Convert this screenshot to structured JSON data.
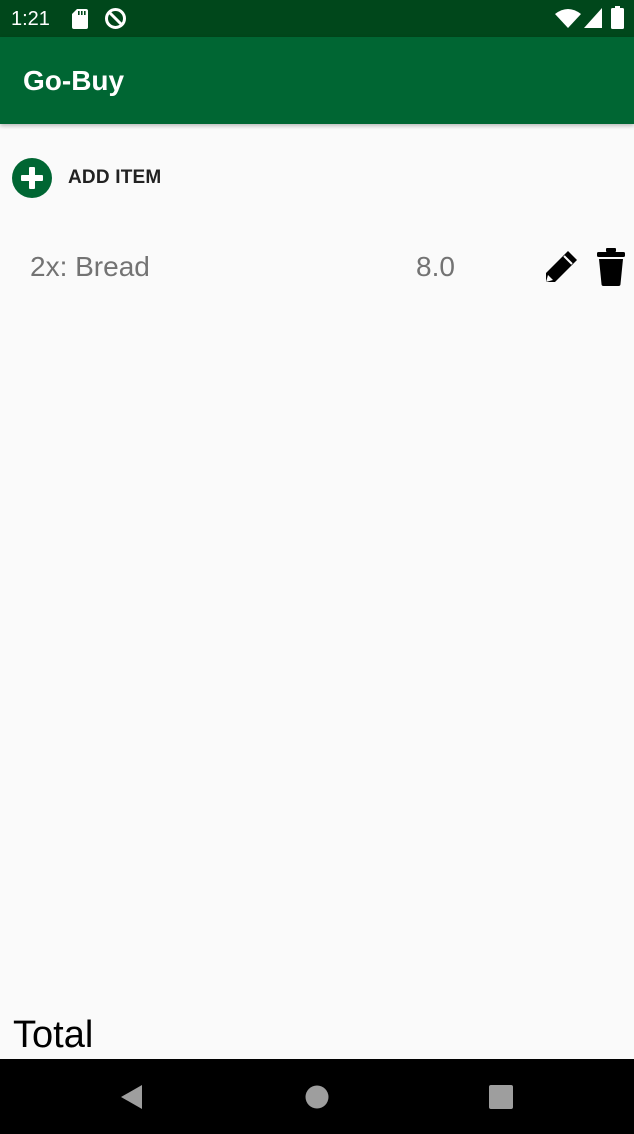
{
  "status_bar": {
    "time": "1:21",
    "icons": [
      "sd-card-icon",
      "data-saver-icon",
      "wifi-icon",
      "signal-icon",
      "battery-icon"
    ]
  },
  "app_bar": {
    "title": "Go-Buy",
    "color": "#006633"
  },
  "add_item": {
    "label": "ADD ITEM",
    "icon": "add-circle-icon",
    "color": "#006633"
  },
  "items": [
    {
      "name": "2x: Bread",
      "price": "8.0"
    }
  ],
  "footer": {
    "total_label": "Total"
  },
  "nav_bar": {
    "buttons": [
      "back-icon",
      "home-icon",
      "recents-icon"
    ]
  }
}
